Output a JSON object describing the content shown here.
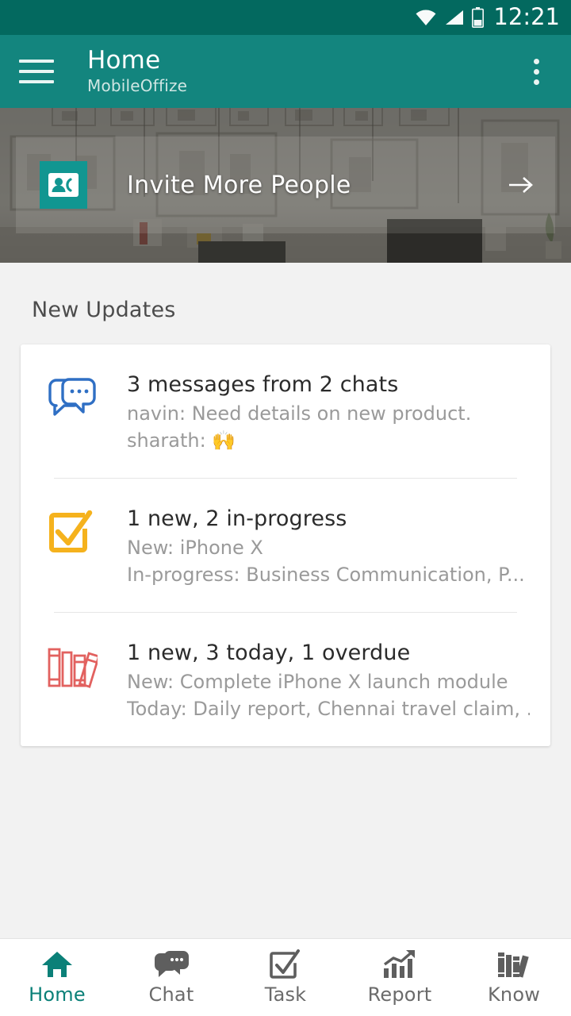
{
  "colors": {
    "status_bar": "#03695f",
    "app_bar": "#13857e",
    "accent_teal": "#119691",
    "active_nav": "#0b8078",
    "page_bg": "#f2f2f2",
    "card_bg": "#ffffff",
    "chat_icon": "#2f6fc4",
    "task_icon": "#f5b21d",
    "know_icon": "#e2615f"
  },
  "status_bar": {
    "time": "12:21",
    "icons": [
      "wifi-icon",
      "cellular-signal-icon",
      "battery-icon"
    ]
  },
  "app_bar": {
    "menu_icon": "hamburger-menu-icon",
    "title": "Home",
    "subtitle": "MobileOffize",
    "overflow_icon": "overflow-menu-icon"
  },
  "hero": {
    "invite": {
      "icon": "contact-card-icon",
      "label": "Invite More People",
      "arrow_icon": "arrow-right-icon"
    }
  },
  "main": {
    "section_title": "New Updates",
    "updates": [
      {
        "icon": "chat-bubbles-icon",
        "title": "3 messages from 2 chats",
        "line1": "navin: Need details on new product.",
        "line2": "sharath: 🙌"
      },
      {
        "icon": "task-checkbox-icon",
        "title": "1 new, 2 in-progress",
        "line1": "New: iPhone X",
        "line2": "In-progress: Business Communication, P..."
      },
      {
        "icon": "books-icon",
        "title": "1 new, 3 today, 1 overdue",
        "line1": "New: Complete iPhone X launch module",
        "line2": "Today: Daily report, Chennai travel claim, ..."
      }
    ]
  },
  "bottom_nav": {
    "items": [
      {
        "label": "Home",
        "icon": "home-icon",
        "active": true
      },
      {
        "label": "Chat",
        "icon": "chat-icon",
        "active": false
      },
      {
        "label": "Task",
        "icon": "task-icon",
        "active": false
      },
      {
        "label": "Report",
        "icon": "report-chart-icon",
        "active": false
      },
      {
        "label": "Know",
        "icon": "books-icon",
        "active": false
      }
    ]
  }
}
